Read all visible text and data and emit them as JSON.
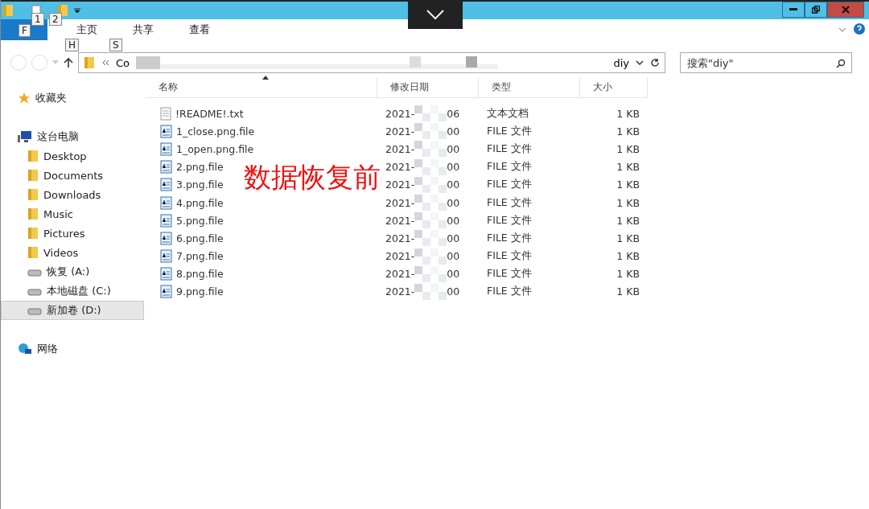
{
  "ribbon": {
    "keytips": [
      {
        "key": "1"
      },
      {
        "key": "2"
      },
      {
        "key": "F"
      },
      {
        "key": "H"
      },
      {
        "key": "S"
      }
    ],
    "tabs": [
      {
        "kind": "file"
      },
      {
        "label": "主页",
        "kind": "tab"
      },
      {
        "label": "共享",
        "kind": "tab"
      },
      {
        "label": "查看",
        "kind": "tab"
      }
    ]
  },
  "address": {
    "start": "Co",
    "end": "diy"
  },
  "search": {
    "placeholder": "搜索\"diy\""
  },
  "sidebar": [
    {
      "label": "收藏夹",
      "kind": "star",
      "selected": false
    },
    {
      "label": "这台电脑",
      "kind": "pc",
      "selected": false,
      "children": [
        {
          "label": "Desktop",
          "kind": "folder",
          "selected": false
        },
        {
          "label": "Documents",
          "kind": "folder",
          "selected": false
        },
        {
          "label": "Downloads",
          "kind": "folder",
          "selected": false
        },
        {
          "label": "Music",
          "kind": "folder",
          "selected": false
        },
        {
          "label": "Pictures",
          "kind": "folder",
          "selected": false
        },
        {
          "label": "Videos",
          "kind": "folder",
          "selected": false
        },
        {
          "label": "恢复 (A:)",
          "kind": "drive",
          "selected": false
        },
        {
          "label": "本地磁盘 (C:)",
          "kind": "drive",
          "selected": false
        },
        {
          "label": "新加卷 (D:)",
          "kind": "drive",
          "selected": true
        }
      ]
    },
    {
      "label": "网络",
      "kind": "network",
      "selected": false
    }
  ],
  "table": {
    "columns": [
      "名称",
      "修改日期",
      "类型",
      "大小"
    ],
    "rows": [
      {
        "name": "!README!.txt",
        "kind": "text",
        "date_start": "2021-",
        "date_end": "06",
        "type": "文本文档",
        "size": "1 KB"
      },
      {
        "name": "1_close.png.file",
        "kind": "file",
        "date_start": "2021-",
        "date_end": "00",
        "type": "FILE 文件",
        "size": "1 KB"
      },
      {
        "name": "1_open.png.file",
        "kind": "file",
        "date_start": "2021-",
        "date_end": "00",
        "type": "FILE 文件",
        "size": "1 KB"
      },
      {
        "name": "2.png.file",
        "kind": "file",
        "date_start": "2021-",
        "date_end": "00",
        "type": "FILE 文件",
        "size": "1 KB"
      },
      {
        "name": "3.png.file",
        "kind": "file",
        "date_start": "2021-",
        "date_end": "00",
        "type": "FILE 文件",
        "size": "1 KB"
      },
      {
        "name": "4.png.file",
        "kind": "file",
        "date_start": "2021-",
        "date_end": "00",
        "type": "FILE 文件",
        "size": "1 KB"
      },
      {
        "name": "5.png.file",
        "kind": "file",
        "date_start": "2021-",
        "date_end": "00",
        "type": "FILE 文件",
        "size": "1 KB"
      },
      {
        "name": "6.png.file",
        "kind": "file",
        "date_start": "2021-",
        "date_end": "00",
        "type": "FILE 文件",
        "size": "1 KB"
      },
      {
        "name": "7.png.file",
        "kind": "file",
        "date_start": "2021-",
        "date_end": "00",
        "type": "FILE 文件",
        "size": "1 KB"
      },
      {
        "name": "8.png.file",
        "kind": "file",
        "date_start": "2021-",
        "date_end": "00",
        "type": "FILE 文件",
        "size": "1 KB"
      },
      {
        "name": "9.png.file",
        "kind": "file",
        "date_start": "2021-",
        "date_end": "00",
        "type": "FILE 文件",
        "size": "1 KB"
      }
    ]
  },
  "caption": "数据恢复前"
}
